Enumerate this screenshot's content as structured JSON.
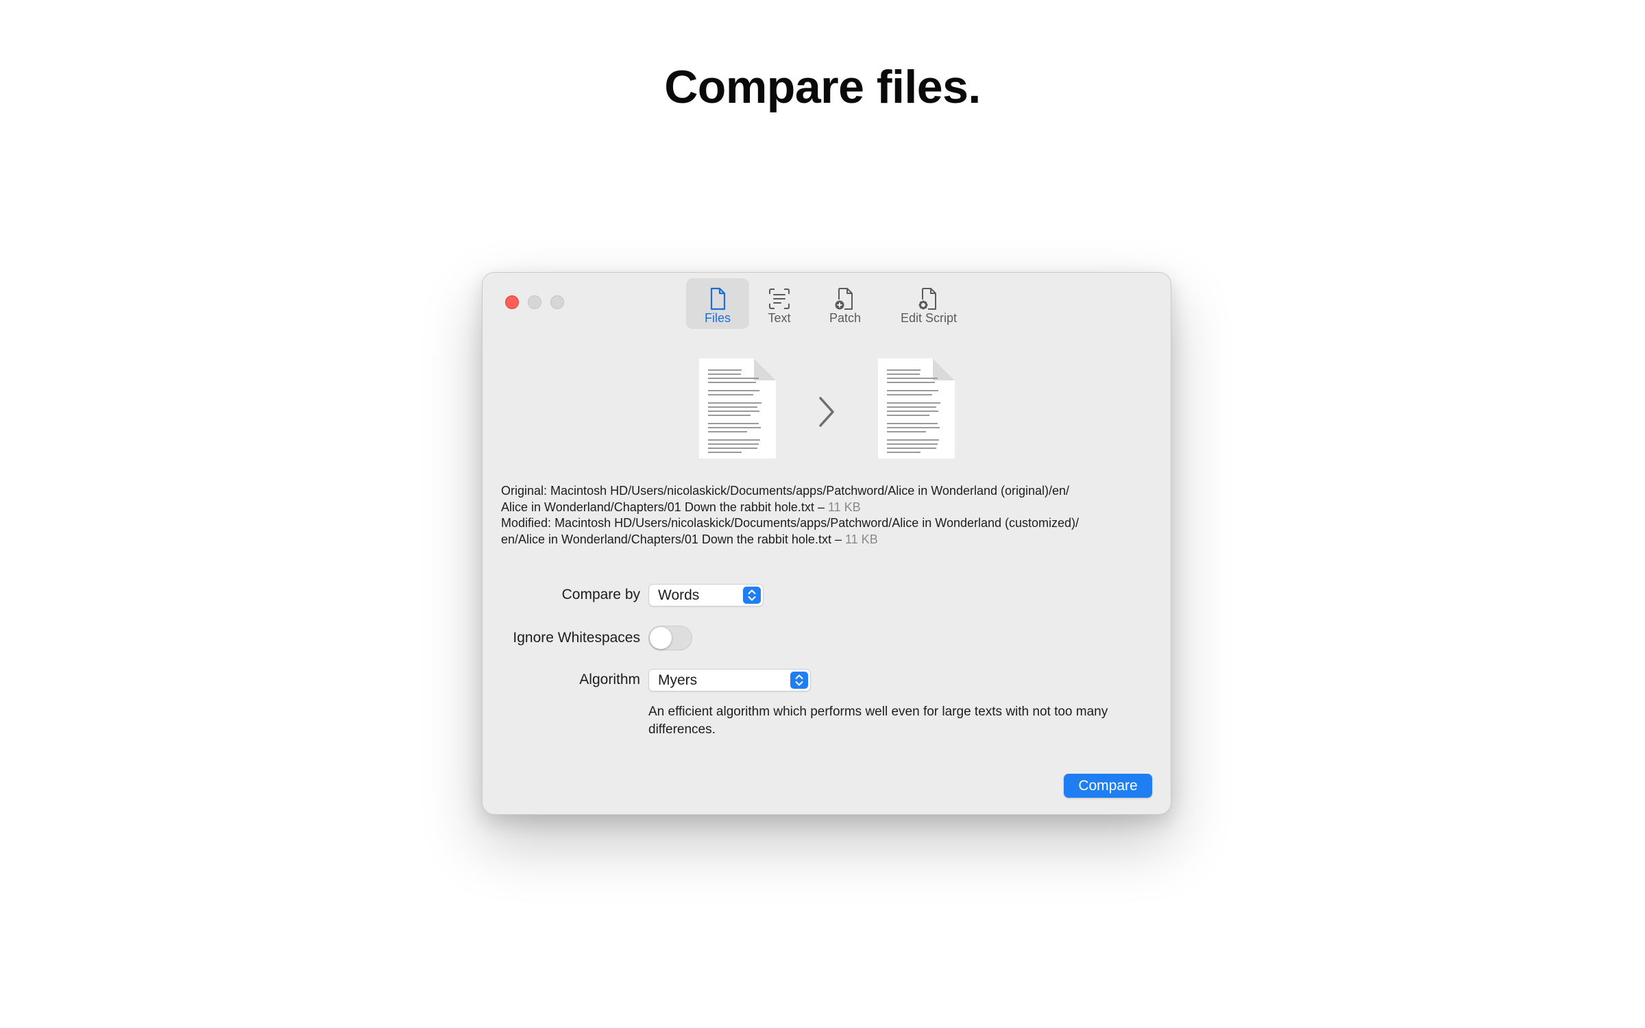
{
  "headline": "Compare files.",
  "window": {
    "toolbar": [
      {
        "label": "Files",
        "icon": "document-icon",
        "selected": true
      },
      {
        "label": "Text",
        "icon": "text-scan-icon",
        "selected": false
      },
      {
        "label": "Patch",
        "icon": "document-plus-icon",
        "selected": false
      },
      {
        "label": "Edit Script",
        "icon": "document-gear-icon",
        "selected": false
      }
    ],
    "files": {
      "original_prefix": "Original:",
      "original_path_1": "Macintosh HD/Users/nicolaskick/Documents/apps/Patchword/Alice in Wonderland (original)/en/",
      "original_path_2": "Alice in Wonderland/Chapters/01 Down the rabbit hole.txt",
      "original_size": "11 KB",
      "modified_prefix": "Modified:",
      "modified_path_1": "Macintosh HD/Users/nicolaskick/Documents/apps/Patchword/Alice in Wonderland (customized)/",
      "modified_path_2": "en/Alice in Wonderland/Chapters/01 Down the rabbit hole.txt",
      "modified_size": "11 KB",
      "separator": "–"
    },
    "form": {
      "compare_by_label": "Compare by",
      "compare_by_value": "Words",
      "ignore_whitespaces_label": "Ignore Whitespaces",
      "ignore_whitespaces_on": false,
      "algorithm_label": "Algorithm",
      "algorithm_value": "Myers",
      "algorithm_description": "An efficient algorithm which performs well even for large texts with not too many differences."
    },
    "compare_button": "Compare"
  },
  "colors": {
    "accent": "#1f7ff2",
    "close": "#ff5f57",
    "window_bg": "#ececec"
  }
}
